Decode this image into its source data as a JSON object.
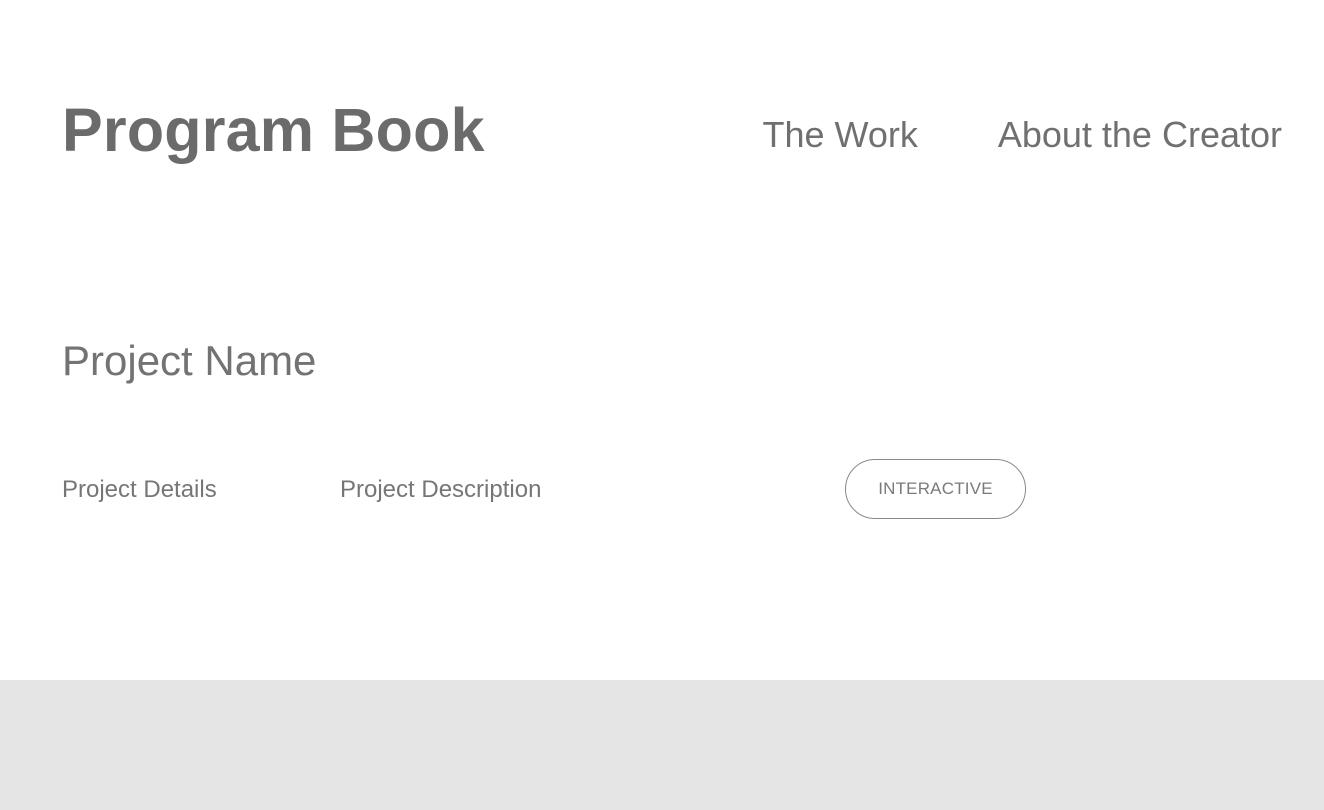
{
  "header": {
    "title": "Program Book",
    "nav": [
      {
        "label": "The Work"
      },
      {
        "label": "About the Creator"
      }
    ]
  },
  "project": {
    "name": "Project Name",
    "details_label": "Project Details",
    "description_label": "Project Description",
    "tag": "INTERACTIVE"
  },
  "colors": {
    "text": "#6f6f6f",
    "background": "#ffffff",
    "footer_band": "#e4e5e4",
    "pill_border": "#8a8a8a"
  }
}
